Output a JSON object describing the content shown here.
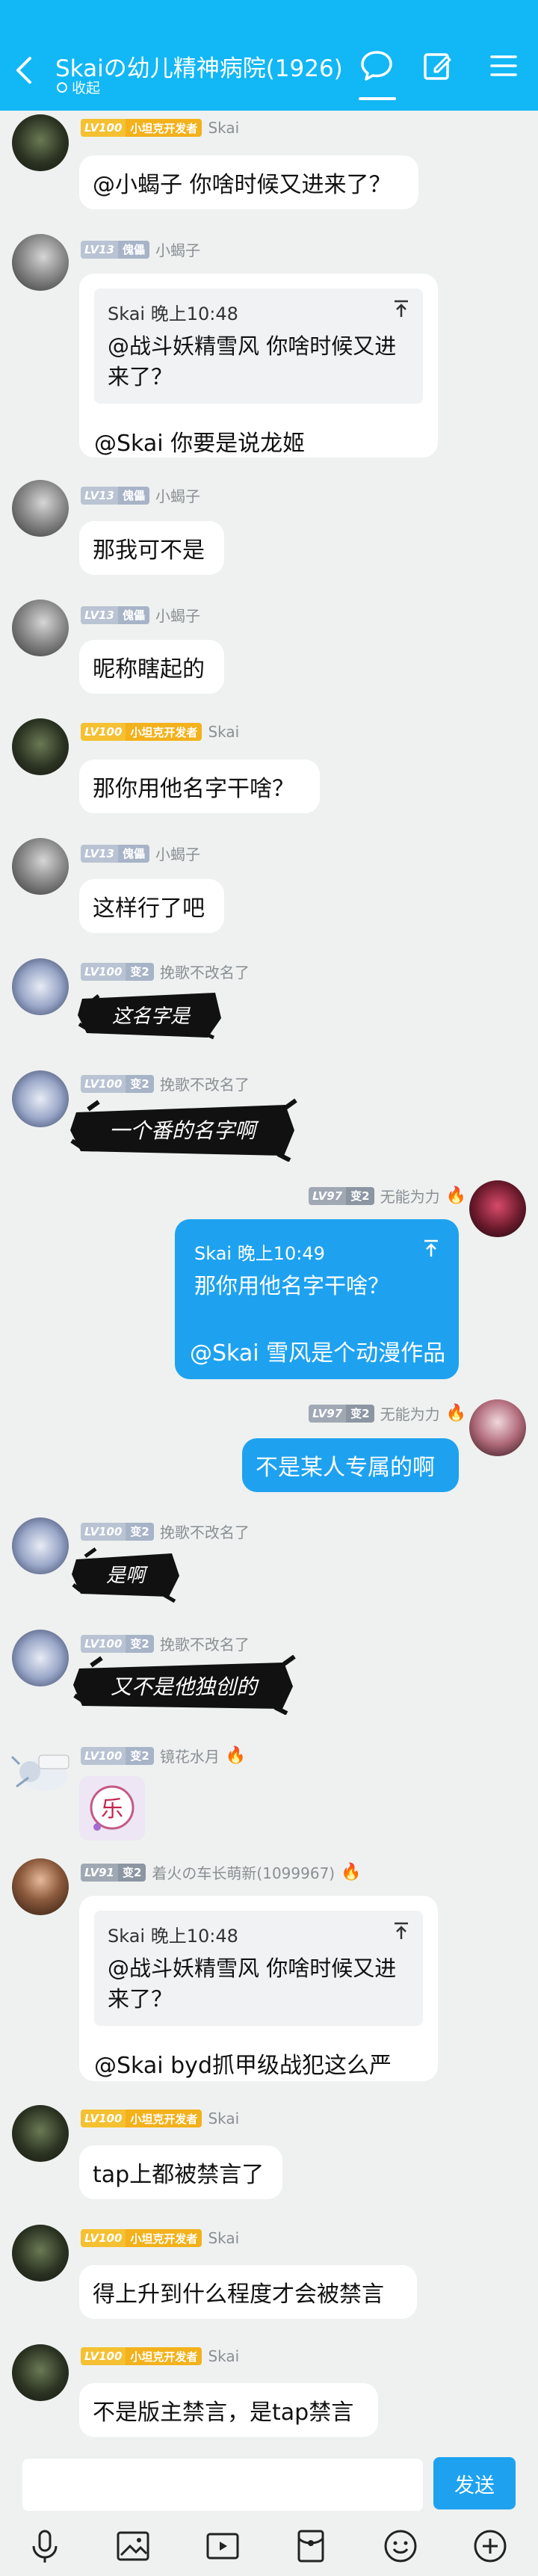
{
  "header": {
    "title": "Skaiの幼儿精神病院(1926)",
    "subtitle": "收起"
  },
  "messages": [
    {
      "name": "Skai",
      "level": "LV100",
      "title": "小坦克开发者",
      "text": "@小蝎子 你啥时候又进来了？"
    },
    {
      "name": "小蝎子",
      "level": "LV13",
      "title": "傀儡",
      "quote_head": "Skai 晚上10:48",
      "quote_text_1": "@战斗妖精雪风 你啥时候又进",
      "quote_text_2": "来了？",
      "reply": "@Skai 你要是说龙姬"
    },
    {
      "name": "小蝎子",
      "level": "LV13",
      "title": "傀儡",
      "text": "那我可不是"
    },
    {
      "name": "小蝎子",
      "level": "LV13",
      "title": "傀儡",
      "text": "昵称瞎起的"
    },
    {
      "name": "Skai",
      "level": "LV100",
      "title": "小坦克开发者",
      "text": "那你用他名字干啥？"
    },
    {
      "name": "小蝎子",
      "level": "LV13",
      "title": "傀儡",
      "text": "这样行了吧"
    },
    {
      "name": "挽歌不改名了",
      "level": "LV100",
      "title": "变2",
      "sticker": "这名字是"
    },
    {
      "name": "挽歌不改名了",
      "level": "LV100",
      "title": "变2",
      "sticker": "一个番的名字啊"
    },
    {
      "name": "无能为力",
      "level": "LV97",
      "title": "变2",
      "quote_head": "Skai 晚上10:49",
      "quote_text_1": "那你用他名字干啥？",
      "reply": "@Skai 雪风是个动漫作品"
    },
    {
      "name": "无能为力",
      "level": "LV97",
      "title": "变2",
      "text": "不是某人专属的啊"
    },
    {
      "name": "挽歌不改名了",
      "level": "LV100",
      "title": "变2",
      "sticker": "是啊"
    },
    {
      "name": "挽歌不改名了",
      "level": "LV100",
      "title": "变2",
      "sticker": "又不是他独创的"
    },
    {
      "name": "镜花水月",
      "level": "LV100",
      "title": "变2",
      "sticker": "乐"
    },
    {
      "name": "着火の车长萌新(1099967)",
      "level": "LV91",
      "title": "变2",
      "quote_head": "Skai 晚上10:48",
      "quote_text_1": "@战斗妖精雪风 你啥时候又进",
      "quote_text_2": "来了？",
      "reply": "@Skai byd抓甲级战犯这么严"
    },
    {
      "name": "Skai",
      "level": "LV100",
      "title": "小坦克开发者",
      "text": "tap上都被禁言了"
    },
    {
      "name": "Skai",
      "level": "LV100",
      "title": "小坦克开发者",
      "text": "得上升到什么程度才会被禁言"
    },
    {
      "name": "Skai",
      "level": "LV100",
      "title": "小坦克开发者",
      "text": "不是版主禁言，是tap禁言"
    }
  ],
  "input": {
    "send_label": "发送"
  },
  "toolbar": [
    "mic-icon",
    "image-icon",
    "video-icon",
    "red-packet-icon",
    "emoji-icon",
    "plus-icon"
  ],
  "colors": {
    "accent": "#12b7f5",
    "send": "#1ea2f0",
    "owner_badge": "#f5c031"
  }
}
